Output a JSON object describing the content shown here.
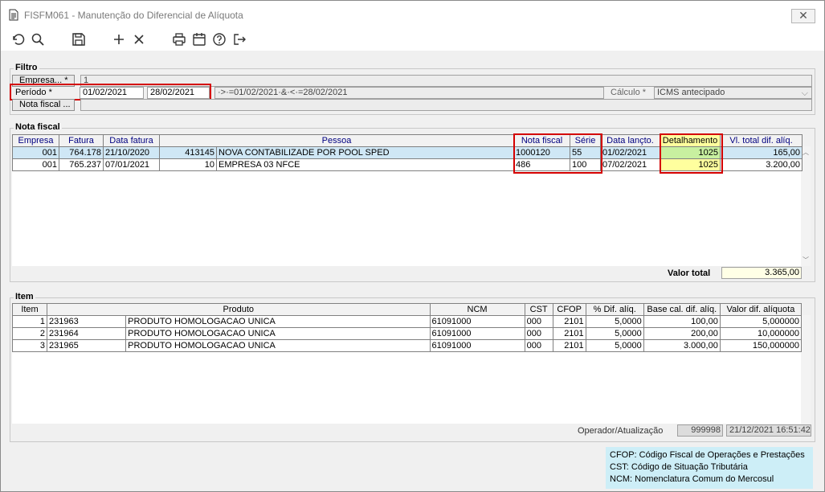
{
  "window": {
    "title": "FISFM061 - Manutenção do Diferencial de Alíquota",
    "close_label": "✕"
  },
  "toolbar": {
    "icons": [
      "undo-icon",
      "search-icon",
      "save-icon",
      "add-icon",
      "delete-icon",
      "print-icon",
      "calendar-icon",
      "help-icon",
      "exit-icon"
    ]
  },
  "filtro": {
    "legend": "Filtro",
    "empresa_label": "Empresa... *",
    "empresa_value": "1",
    "periodo_label": "Período *",
    "periodo_start": "01/02/2021",
    "periodo_end": "28/02/2021",
    "periodo_expr": "·>·=01/02/2021·&·<·=28/02/2021",
    "calculo_label": "Cálculo *",
    "calculo_value": "ICMS antecipado",
    "nota_label": "Nota fiscal ...",
    "nota_value": ""
  },
  "nota": {
    "legend": "Nota fiscal",
    "columns": [
      "Empresa",
      "Fatura",
      "Data fatura",
      "Pessoa",
      "Nota fiscal",
      "Série",
      "Data lançto.",
      "Detalhamento",
      "Vl. total dif. alíq."
    ],
    "rows": [
      {
        "empresa": "001",
        "fatura": "764.178",
        "data_fatura": "21/10/2020",
        "pessoa_cod": "413145",
        "pessoa_nome": "NOVA CONTABILIZADE POR POOL SPED",
        "nota_fiscal": "1000120",
        "serie": "55",
        "data_lancto": "01/02/2021",
        "detalhamento": "1025",
        "vl_total": "165,00"
      },
      {
        "empresa": "001",
        "fatura": "765.237",
        "data_fatura": "07/01/2021",
        "pessoa_cod": "10",
        "pessoa_nome": "EMPRESA 03 NFCE",
        "nota_fiscal": "486",
        "serie": "100",
        "data_lancto": "07/02/2021",
        "detalhamento": "1025",
        "vl_total": "3.200,00"
      }
    ],
    "valor_total_label": "Valor total",
    "valor_total": "3.365,00"
  },
  "item": {
    "legend": "Item",
    "columns": [
      "Item",
      "Produto",
      "NCM",
      "CST",
      "CFOP",
      "% Dif. alíq.",
      "Base cal. dif. alíq.",
      "Valor dif. alíquota"
    ],
    "rows": [
      {
        "item": "1",
        "cod": "231963",
        "produto": "PRODUTO HOMOLOGACAO UNICA",
        "ncm": "61091000",
        "cst": "000",
        "cfop": "2101",
        "pct": "5,0000",
        "base": "100,00",
        "valor": "5,000000"
      },
      {
        "item": "2",
        "cod": "231964",
        "produto": "PRODUTO HOMOLOGACAO UNICA",
        "ncm": "61091000",
        "cst": "000",
        "cfop": "2101",
        "pct": "5,0000",
        "base": "200,00",
        "valor": "10,000000"
      },
      {
        "item": "3",
        "cod": "231965",
        "produto": "PRODUTO HOMOLOGACAO UNICA",
        "ncm": "61091000",
        "cst": "000",
        "cfop": "2101",
        "pct": "5,0000",
        "base": "3.000,00",
        "valor": "150,000000"
      }
    ],
    "operador_label": "Operador/Atualização",
    "operador_value": "999998",
    "atualizacao_value": "21/12/2021 16:51:42"
  },
  "legend_box": {
    "cfop": "CFOP: Código Fiscal de Operações e Prestações",
    "cst": "CST: Código de Situação Tributária",
    "ncm": "NCM: Nomenclatura Comum do Mercosul"
  },
  "colors": {
    "highlight_red": "#d40000",
    "selected_row": "#cfe7f5",
    "yellow": "#ffff9e",
    "green": "#c8f0a0",
    "legend_bg": "#cdeef7"
  }
}
